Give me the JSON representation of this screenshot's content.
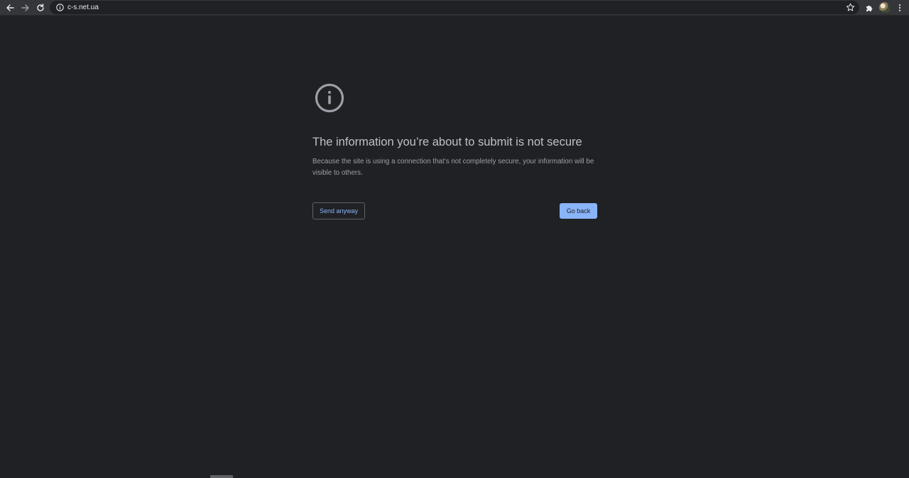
{
  "browser": {
    "url": "c-s.net.ua",
    "icons": {
      "back": "back-arrow-icon",
      "forward": "forward-arrow-icon",
      "reload": "reload-icon",
      "site_info": "info-icon",
      "bookmark": "star-icon",
      "extensions": "puzzle-icon",
      "profile": "avatar",
      "menu": "kebab-menu-icon"
    }
  },
  "interstitial": {
    "icon": "info-circle-icon",
    "heading": "The information you’re about to submit is not secure",
    "explanation": "Because the site is using a connection that’s not completely secure, your information will be visible to others.",
    "send_anyway_label": "Send anyway",
    "go_back_label": "Go back"
  },
  "colors": {
    "page_background": "#202124",
    "toolbar_background": "#35363a",
    "accent": "#8ab4f8",
    "heading_text": "#bdc1c6",
    "body_text": "#9aa0a6"
  }
}
